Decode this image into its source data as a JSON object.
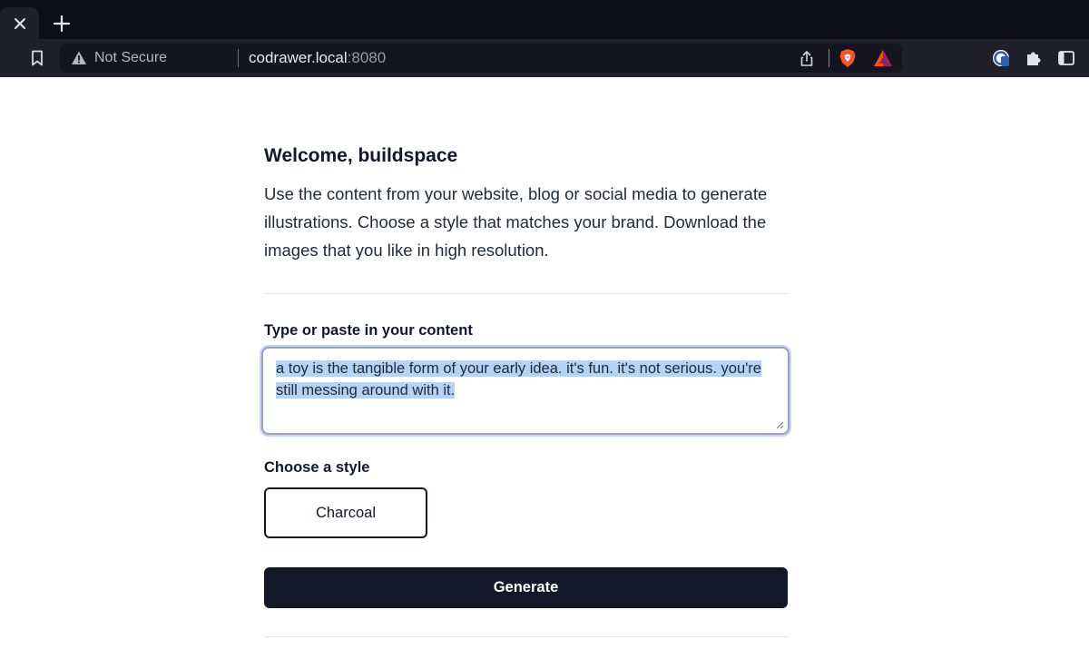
{
  "browser": {
    "address_bar": {
      "security_label": "Not Secure",
      "url_host": "codrawer.local",
      "url_port": ":8080"
    },
    "icons": [
      "close-icon",
      "plus-icon",
      "bookmark-icon",
      "warning-icon",
      "share-icon",
      "brave-shields-icon",
      "brave-rewards-icon",
      "extension-badge-icon",
      "puzzle-extensions-icon",
      "sidebar-icon"
    ],
    "colors": {
      "tabstrip": "#0d0e19",
      "toolbar": "#202128",
      "omnibox": "#141520"
    }
  },
  "page": {
    "welcome_title": "Welcome, buildspace",
    "intro": "Use the content from your website, blog or social media to generate illustrations. Choose a style that matches your brand. Download the images that you like in high resolution.",
    "content_label": "Type or paste in your content",
    "content_value": "a toy is the tangible form of your early idea. it's fun. it's not serious. you're still messing around with it.",
    "style_label": "Choose a style",
    "style_option": "Charcoal",
    "generate_label": "Generate",
    "colors": {
      "primary_button": "#111827",
      "selection": "#b4d3f8",
      "focus_ring": "#c7d2fe"
    }
  }
}
